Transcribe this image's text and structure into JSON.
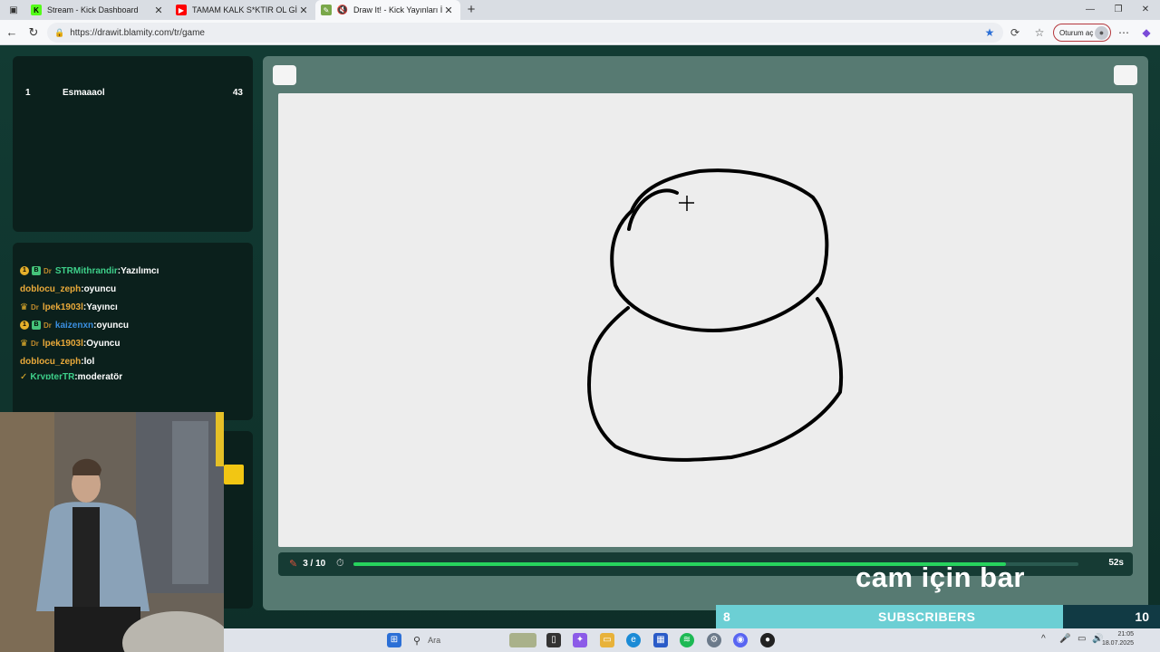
{
  "browser": {
    "tabs": [
      {
        "title": "Stream - Kick Dashboard",
        "favicon": "kick-icon",
        "color": "#53fc18"
      },
      {
        "title": "TAMAM KALK S*KTIR OL GİT | Ge",
        "favicon": "youtube-icon",
        "color": "#ff0000"
      },
      {
        "title": "Draw It! - Kick Yayınları İçin (",
        "favicon": "drawit-icon",
        "color": "#7aa84a",
        "active": true
      }
    ],
    "url": "https://drawit.blamity.com/tr/game",
    "signin_label": "Oturum aç"
  },
  "scoreboard": {
    "rows": [
      {
        "rank": "1",
        "name": "Esmaaaol",
        "points": "43"
      }
    ]
  },
  "chat": {
    "messages": [
      {
        "user": "STRMithrandir",
        "text": "Yazılımcı",
        "user_color": "green"
      },
      {
        "user": "doblocu_zeph",
        "text": "oyuncu",
        "user_color": "orange"
      },
      {
        "user": "lpek1903l",
        "text": "Yayıncı",
        "user_color": "orange"
      },
      {
        "user": "kaizenxn",
        "text": "oyuncu",
        "user_color": "blue"
      },
      {
        "user": "lpek1903l",
        "text": "Oyuncu",
        "user_color": "orange"
      },
      {
        "user": "doblocu_zeph",
        "text": "lol",
        "user_color": "orange"
      },
      {
        "user": "KrypterTR",
        "text": "moderatör",
        "user_color": "green"
      }
    ]
  },
  "game": {
    "round": "3 / 10",
    "seconds_left": "52s",
    "time_progress": 0.9
  },
  "overlay": {
    "cam_text": "cam için bar",
    "subscribers_label": "SUBSCRIBERS",
    "subscribers_current": "8",
    "subscribers_goal": "10"
  },
  "taskbar": {
    "search_placeholder": "Ara",
    "time": "21:05",
    "date": "18.07.2025"
  },
  "colors": {
    "progress": "#27d35d",
    "accent_yellow": "#f2c613",
    "page_bg": "#123b33"
  }
}
